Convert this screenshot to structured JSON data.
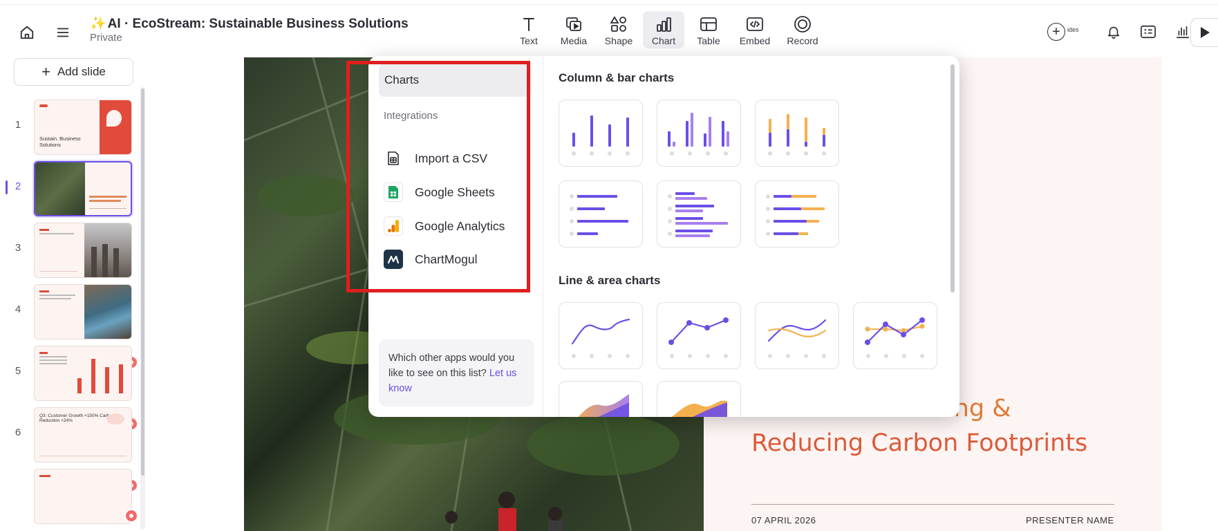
{
  "app": {
    "doc_title": "AI · EcoStream: Sustainable Business Solutions",
    "doc_title_icon": "sparkle-icon",
    "visibility": "Private"
  },
  "toolbar": {
    "items": [
      {
        "label": "Text",
        "icon": "text-icon"
      },
      {
        "label": "Media",
        "icon": "media-icon"
      },
      {
        "label": "Shape",
        "icon": "shape-icon"
      },
      {
        "label": "Chart",
        "icon": "chart-icon",
        "active": true
      },
      {
        "label": "Table",
        "icon": "table-icon"
      },
      {
        "label": "Embed",
        "icon": "embed-icon"
      },
      {
        "label": "Record",
        "icon": "record-icon"
      }
    ],
    "right_partial_label": "ides"
  },
  "sidebar": {
    "add_slide_label": "Add slide",
    "slides": [
      {
        "number": "1",
        "text": "Sustain. Business Solutions"
      },
      {
        "number": "2",
        "text": "",
        "active": true
      },
      {
        "number": "3",
        "text": ""
      },
      {
        "number": "4",
        "text": ""
      },
      {
        "number": "5",
        "text": ""
      },
      {
        "number": "6",
        "text": "Q3: Customer Growth +150% Carbon Reduction +24%"
      },
      {
        "number": "",
        "text": ""
      }
    ]
  },
  "slide": {
    "heading_line1": "ing &",
    "heading_line2": "Reducing Carbon Footprints",
    "date": "07 APRIL 2026",
    "presenter": "PRESENTER NAME"
  },
  "chart_picker": {
    "selected_category": "Charts",
    "integrations_heading": "Integrations",
    "integrations": [
      {
        "label": "Import a CSV",
        "icon": "csv-file-icon"
      },
      {
        "label": "Google Sheets",
        "icon": "google-sheets-icon"
      },
      {
        "label": "Google Analytics",
        "icon": "google-analytics-icon"
      },
      {
        "label": "ChartMogul",
        "icon": "chartmogul-icon"
      }
    ],
    "feedback_text": "Which other apps would you like to see on this list?",
    "feedback_link": "Let us know",
    "groups": [
      {
        "title": "Column & bar charts"
      },
      {
        "title": "Line & area charts"
      }
    ]
  },
  "colors": {
    "accent": "#6b4ee6",
    "accent_light": "#a77ff0",
    "orange": "#f5b04e",
    "highlight": "#e01e1e",
    "slide_heading": "#de5a3a"
  }
}
